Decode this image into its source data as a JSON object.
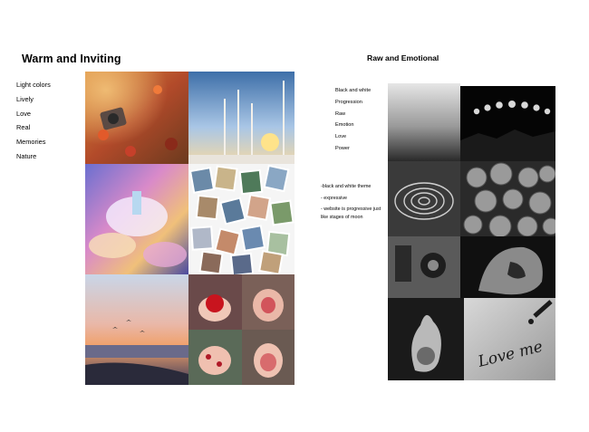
{
  "left_board": {
    "title": "Warm and Inviting",
    "keywords": [
      "Light colors",
      "Lively",
      "Love",
      "Real",
      "Memories",
      "Nature"
    ]
  },
  "right_board": {
    "title": "Raw and Emotional",
    "keywords": [
      "Black and white",
      "Progression",
      "Raw",
      "Emotion",
      "Love",
      "Power"
    ],
    "notes": [
      "-black and white theme",
      "- expressive",
      "- website is progressive just like stages of moon"
    ],
    "handwriting": "Love me"
  }
}
